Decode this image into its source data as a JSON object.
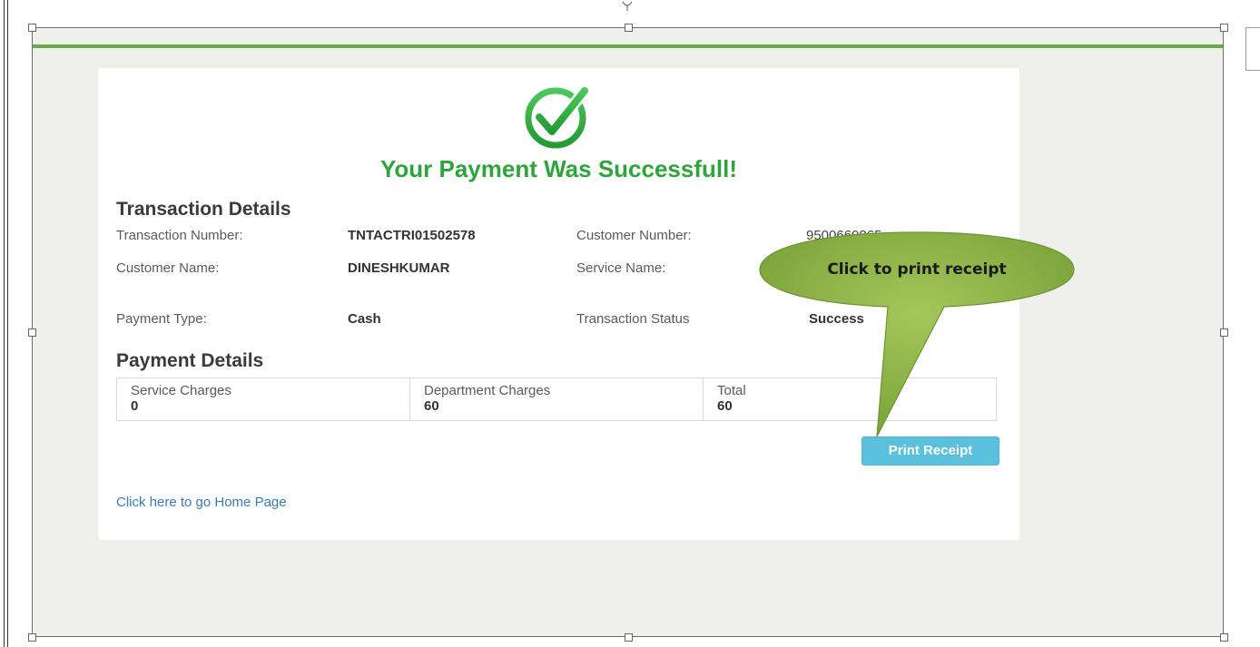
{
  "header": {
    "title": "Your Payment Was Successfull!"
  },
  "transaction": {
    "section_title": "Transaction Details",
    "transaction_number_label": "Transaction Number:",
    "transaction_number": "TNTACTRI01502578",
    "customer_number_label": "Customer Number:",
    "customer_number": "9500660865",
    "customer_name_label": "Customer Name:",
    "customer_name": "DINESHKUMAR",
    "service_name_label": "Service Name:",
    "payment_type_label": "Payment Type:",
    "payment_type": "Cash",
    "status_label": "Transaction Status",
    "status": "Success"
  },
  "payment": {
    "section_title": "Payment Details",
    "columns": [
      {
        "label": "Service Charges",
        "value": "0"
      },
      {
        "label": "Department Charges",
        "value": "60"
      },
      {
        "label": "Total",
        "value": "60"
      }
    ]
  },
  "actions": {
    "print_label": "Print Receipt",
    "home_link": "Click here to go Home Page"
  },
  "callout": {
    "text": "Click to print receipt"
  },
  "colors": {
    "success_green": "#2ea43c",
    "accent_bar": "#6aaa48",
    "button_blue": "#5bc0de",
    "callout_green": "#8db34a"
  },
  "icons": {
    "success": "check-circle-icon"
  }
}
